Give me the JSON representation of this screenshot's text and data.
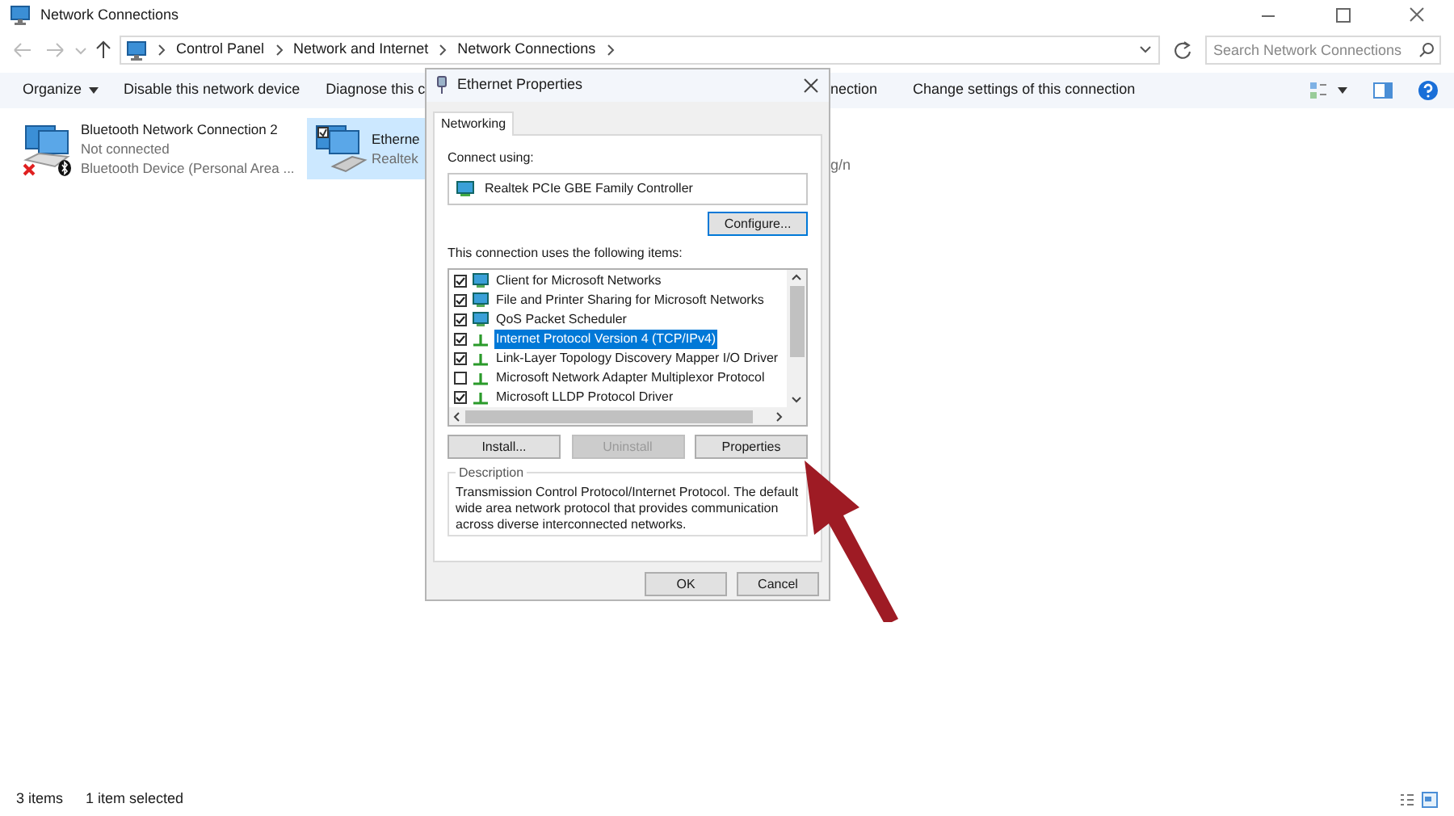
{
  "window": {
    "title": "Network Connections"
  },
  "address_bar": {
    "path": [
      "Control Panel",
      "Network and Internet",
      "Network Connections"
    ]
  },
  "search": {
    "placeholder": "Search Network Connections"
  },
  "toolbar": {
    "items": [
      {
        "label": "Organize",
        "dropdown": true
      },
      {
        "label": "Disable this network device",
        "dropdown": false
      },
      {
        "label": "Diagnose this c",
        "dropdown": false
      }
    ],
    "items_right": [
      {
        "label": "nection"
      },
      {
        "label": "Change settings of this connection"
      }
    ]
  },
  "connections": [
    {
      "kind": "bluetooth",
      "name": "Bluetooth Network Connection 2",
      "status": "Not connected",
      "device": "Bluetooth Device (Personal Area ...",
      "selected": false
    },
    {
      "kind": "ethernet",
      "name": "Etherne",
      "device": "Realtek",
      "selected": true
    }
  ],
  "partial_text": "g/n",
  "dialog": {
    "title": "Ethernet Properties",
    "tabs": [
      {
        "label": "Networking",
        "selected": true
      }
    ],
    "connect_using_label": "Connect using:",
    "adapter": "Realtek PCIe GBE Family Controller",
    "configure_button": "Configure...",
    "items_label": "This connection uses the following items:",
    "items": [
      {
        "kind": "client",
        "label": "Client for Microsoft Networks",
        "checked": true,
        "selected": false
      },
      {
        "kind": "service",
        "label": "File and Printer Sharing for Microsoft Networks",
        "checked": true,
        "selected": false
      },
      {
        "kind": "service",
        "label": "QoS Packet Scheduler",
        "checked": true,
        "selected": false
      },
      {
        "kind": "protocol",
        "label": "Internet Protocol Version 4 (TCP/IPv4)",
        "checked": true,
        "selected": true
      },
      {
        "kind": "protocol",
        "label": "Link-Layer Topology Discovery Mapper I/O Driver",
        "checked": true,
        "selected": false
      },
      {
        "kind": "protocol",
        "label": "Microsoft Network Adapter Multiplexor Protocol",
        "checked": false,
        "selected": false
      },
      {
        "kind": "protocol",
        "label": "Microsoft LLDP Protocol Driver",
        "checked": true,
        "selected": false
      }
    ],
    "item_buttons": [
      {
        "label": "Install...",
        "disabled": false
      },
      {
        "label": "Uninstall",
        "disabled": true
      },
      {
        "label": "Properties",
        "disabled": false
      }
    ],
    "description": {
      "title": "Description",
      "text": "Transmission Control Protocol/Internet Protocol. The default wide area network protocol that provides communication across diverse interconnected networks."
    },
    "footer_buttons": [
      {
        "label": "OK"
      },
      {
        "label": "Cancel"
      }
    ]
  },
  "status_bar": {
    "item_count": "3 items",
    "selection": "1 item selected"
  }
}
